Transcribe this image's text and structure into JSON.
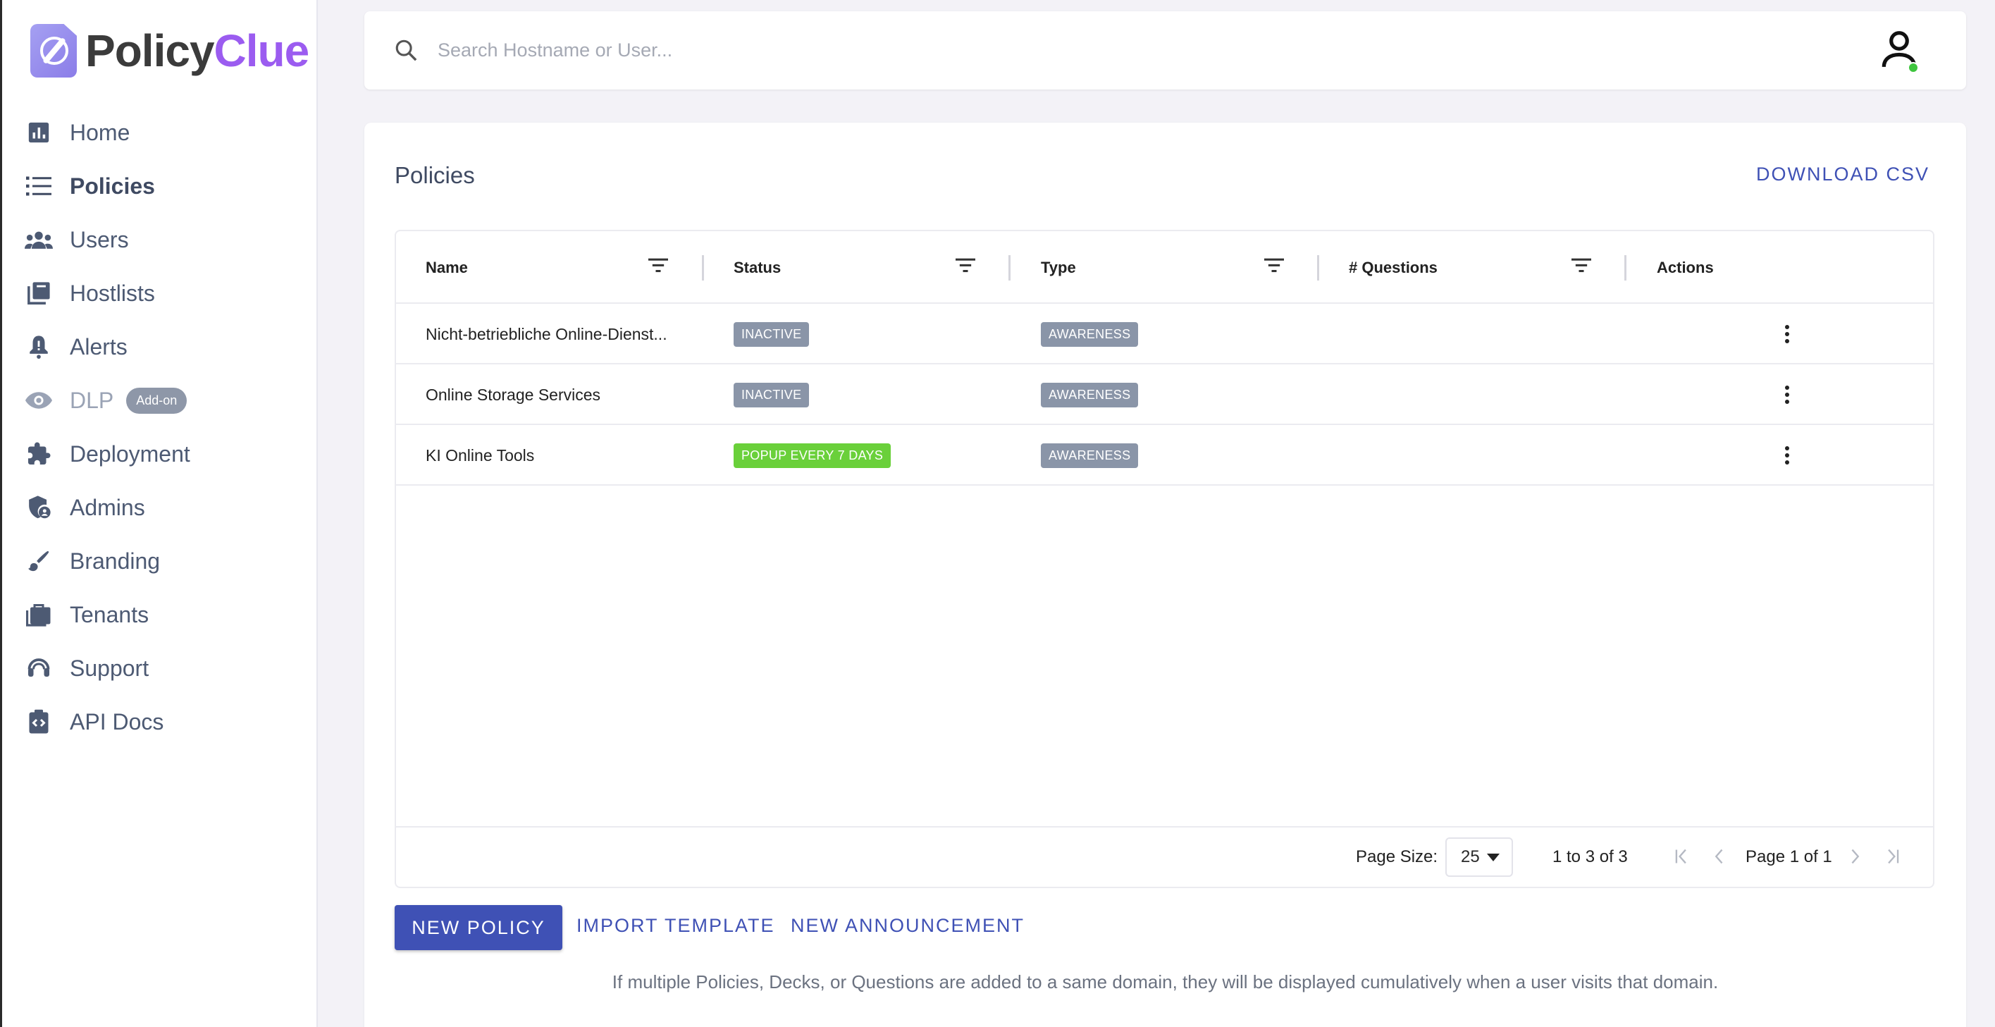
{
  "brand": {
    "name_part1": "Policy",
    "name_part2": "Clue"
  },
  "sidebar": {
    "items": [
      {
        "label": "Home",
        "icon": "chart-icon"
      },
      {
        "label": "Policies",
        "icon": "list-icon"
      },
      {
        "label": "Users",
        "icon": "users-icon"
      },
      {
        "label": "Hostlists",
        "icon": "library-icon"
      },
      {
        "label": "Alerts",
        "icon": "bell-icon"
      },
      {
        "label": "DLP",
        "icon": "eye-icon",
        "badge": "Add-on"
      },
      {
        "label": "Deployment",
        "icon": "puzzle-icon"
      },
      {
        "label": "Admins",
        "icon": "admin-shield-icon"
      },
      {
        "label": "Branding",
        "icon": "brush-icon"
      },
      {
        "label": "Tenants",
        "icon": "briefcase-icon"
      },
      {
        "label": "Support",
        "icon": "headset-icon"
      },
      {
        "label": "API Docs",
        "icon": "code-clipboard-icon"
      }
    ]
  },
  "search": {
    "placeholder": "Search Hostname or User..."
  },
  "main": {
    "title": "Policies",
    "download_label": "DOWNLOAD CSV",
    "columns": [
      "Name",
      "Status",
      "Type",
      "# Questions",
      "Actions"
    ],
    "rows": [
      {
        "name": "Nicht-betriebliche Online-Dienst...",
        "status": "INACTIVE",
        "type": "AWARENESS",
        "questions": ""
      },
      {
        "name": "Online Storage Services",
        "status": "INACTIVE",
        "type": "AWARENESS",
        "questions": ""
      },
      {
        "name": "KI Online Tools",
        "status": "POPUP EVERY 7 DAYS",
        "type": "AWARENESS",
        "questions": ""
      }
    ],
    "pager": {
      "page_size_label": "Page Size:",
      "page_size": "25",
      "range": "1 to 3 of 3",
      "page_info": "Page 1 of 1"
    },
    "buttons": {
      "new_policy": "NEW POLICY",
      "import_template": "IMPORT TEMPLATE",
      "new_announcement": "NEW ANNOUNCEMENT"
    },
    "note": "If multiple Policies, Decks, or Questions are added to a same domain, they will be displayed cumulatively when a user visits that domain."
  },
  "colors": {
    "accent": "#3f51b5",
    "brand_purple": "#9b5cf0",
    "inactive_badge": "#8a95a8",
    "active_badge": "#6ad03a",
    "online_status": "#3ec53e"
  }
}
